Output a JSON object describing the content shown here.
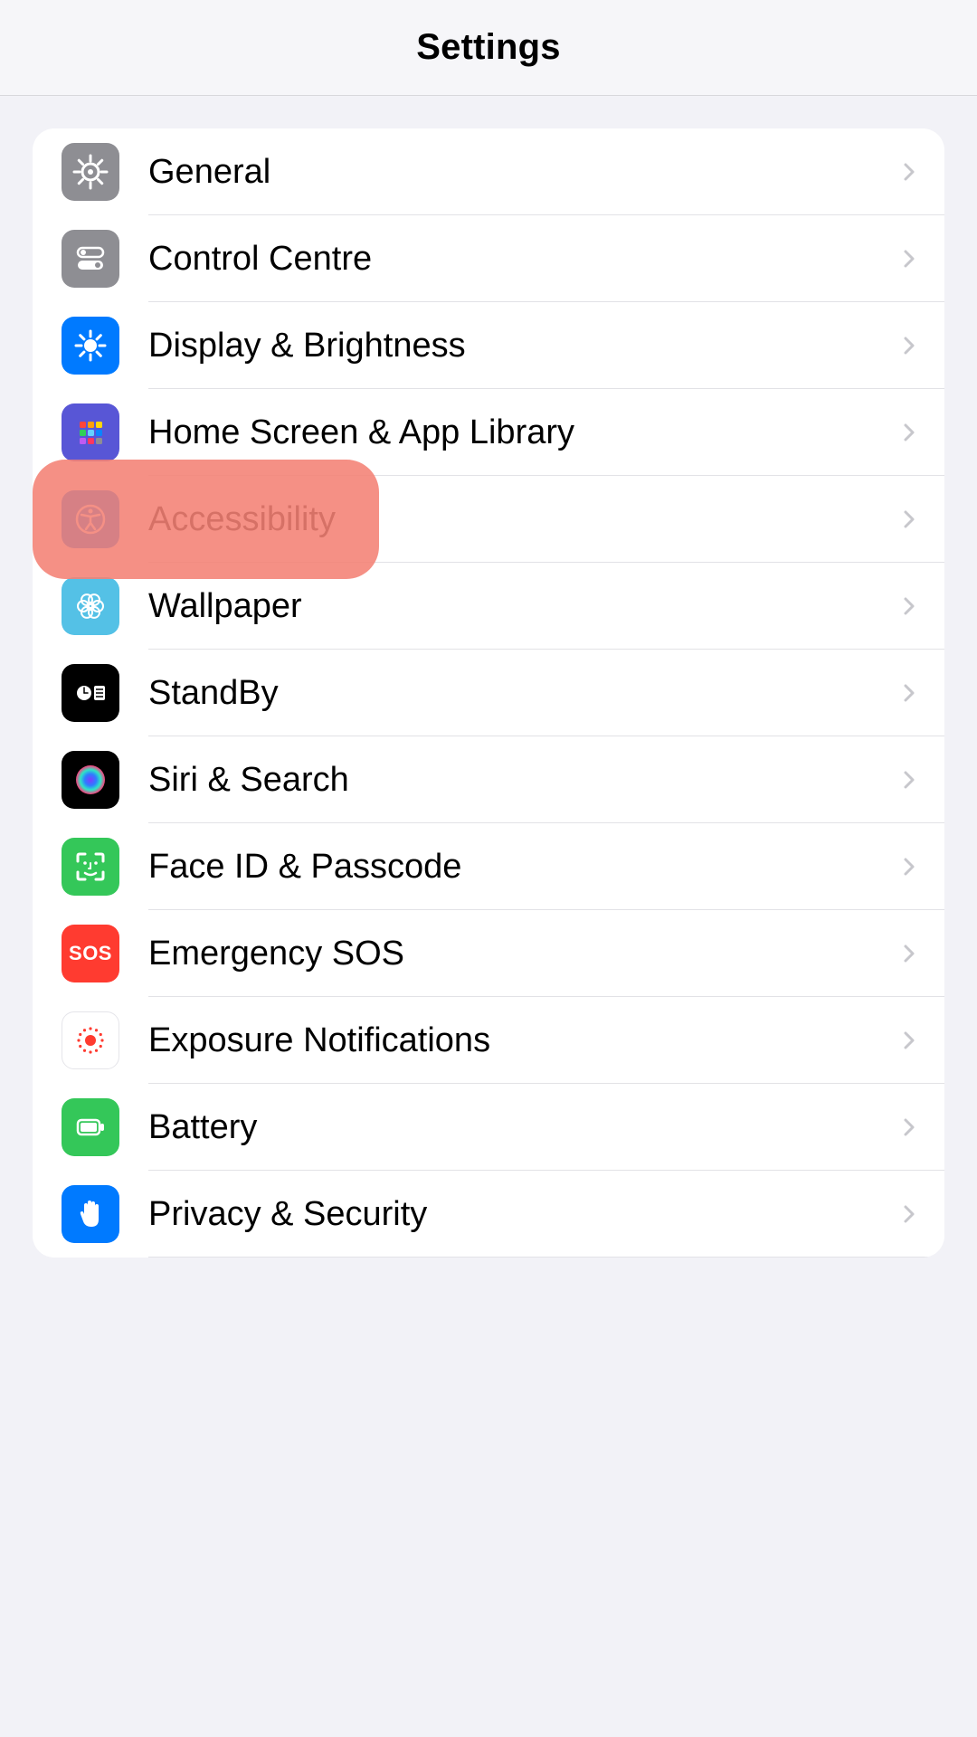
{
  "header": {
    "title": "Settings"
  },
  "rows": [
    {
      "id": "general",
      "label": "General",
      "icon": "gear",
      "bg": "bg-grey"
    },
    {
      "id": "control-centre",
      "label": "Control Centre",
      "icon": "toggles",
      "bg": "bg-grey"
    },
    {
      "id": "display-brightness",
      "label": "Display & Brightness",
      "icon": "sun",
      "bg": "bg-blue"
    },
    {
      "id": "home-screen",
      "label": "Home Screen & App Library",
      "icon": "app-grid",
      "bg": "bg-indigo"
    },
    {
      "id": "accessibility",
      "label": "Accessibility",
      "icon": "accessibility",
      "bg": "bg-blue"
    },
    {
      "id": "wallpaper",
      "label": "Wallpaper",
      "icon": "flower",
      "bg": "bg-teal"
    },
    {
      "id": "standby",
      "label": "StandBy",
      "icon": "standby",
      "bg": "bg-black"
    },
    {
      "id": "siri-search",
      "label": "Siri & Search",
      "icon": "siri",
      "bg": "bg-black"
    },
    {
      "id": "faceid-passcode",
      "label": "Face ID & Passcode",
      "icon": "faceid",
      "bg": "bg-green"
    },
    {
      "id": "emergency-sos",
      "label": "Emergency SOS",
      "icon": "sos",
      "bg": "bg-red"
    },
    {
      "id": "exposure-notif",
      "label": "Exposure Notifications",
      "icon": "exposure",
      "bg": "bg-white"
    },
    {
      "id": "battery",
      "label": "Battery",
      "icon": "battery",
      "bg": "bg-green"
    },
    {
      "id": "privacy-security",
      "label": "Privacy & Security",
      "icon": "hand",
      "bg": "bg-blue"
    }
  ],
  "highlight": {
    "row_id": "accessibility"
  },
  "icons": {
    "sos_text": "SOS"
  }
}
